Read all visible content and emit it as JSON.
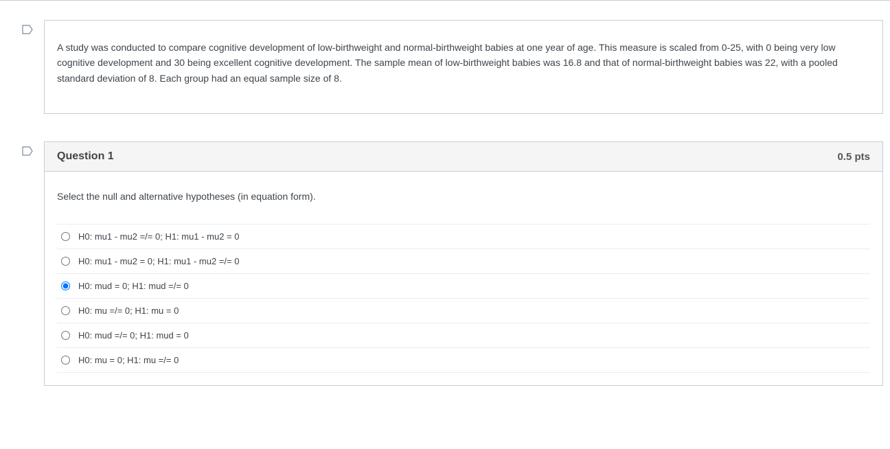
{
  "info": {
    "text": "A study was conducted to compare cognitive development of low-birthweight and normal-birthweight babies at one year of age. This measure is scaled from 0-25, with 0 being very low cognitive development and 30 being excellent cognitive development. The sample mean of low-birthweight babies was 16.8 and that of normal-birthweight babies was 22, with a pooled standard deviation of 8.  Each group had an equal sample size of 8."
  },
  "question": {
    "title": "Question 1",
    "points": "0.5 pts",
    "prompt": "Select the null and alternative hypotheses (in equation form).",
    "selected_index": 2,
    "options": [
      "H0: mu1 - mu2 =/= 0; H1: mu1 - mu2 = 0",
      "H0: mu1 - mu2 = 0; H1: mu1 - mu2 =/= 0",
      "H0: mud = 0; H1: mud =/= 0",
      "H0: mu =/= 0; H1: mu = 0",
      "H0: mud =/= 0; H1: mud = 0",
      "H0: mu = 0; H1: mu =/= 0"
    ]
  }
}
